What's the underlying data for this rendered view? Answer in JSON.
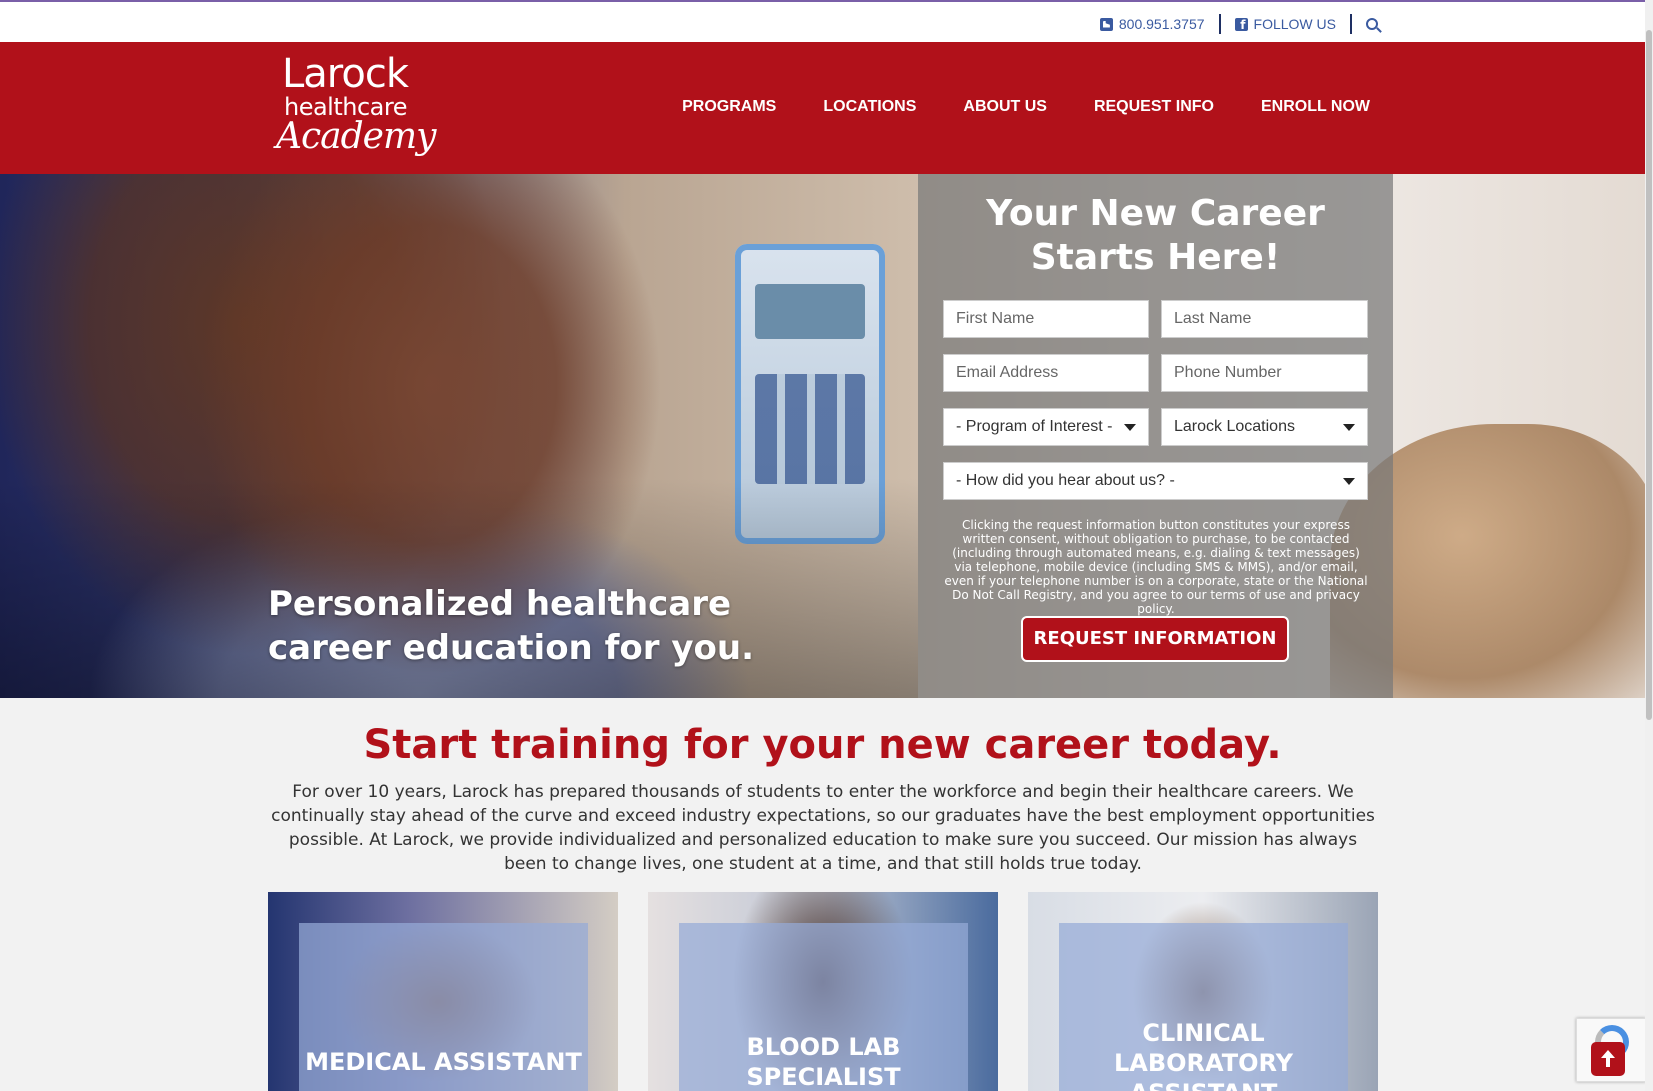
{
  "utility": {
    "phone": "800.951.3757",
    "follow": "FOLLOW US"
  },
  "logo": {
    "line1": "Larock",
    "line2": "healthcare",
    "line3": "Academy"
  },
  "nav": {
    "programs": "PROGRAMS",
    "locations": "LOCATIONS",
    "about": "ABOUT US",
    "request": "REQUEST INFO",
    "enroll": "ENROLL NOW"
  },
  "hero": {
    "tagline": "Personalized healthcare career education for you."
  },
  "form": {
    "title": "Your New Career Starts Here!",
    "first_name": "First Name",
    "last_name": "Last Name",
    "email": "Email Address",
    "phone": "Phone Number",
    "program": "- Program of Interest -",
    "location": "Larock Locations",
    "heard": "- How did you hear about us? -",
    "disclaimer": "Clicking the request information button constitutes your express written consent, without obligation to purchase, to be contacted (including through automated means, e.g. dialing & text messages) via telephone, mobile device (including SMS & MMS), and/or email, even if your telephone number is on a corporate, state or the National Do Not Call Registry, and you agree to our terms of use and privacy policy.",
    "submit": "REQUEST INFORMATION"
  },
  "intro": {
    "title": "Start training for your new career today.",
    "text": "For over 10 years, Larock has prepared thousands of students to enter the workforce and begin their healthcare careers. We continually stay ahead of the curve and exceed industry expectations, so our graduates have the best employment opportunities possible. At Larock, we provide individualized and personalized education to make sure you succeed. Our mission has always been to change lives, one student at a time, and that still holds true today."
  },
  "programs": [
    {
      "label": "MEDICAL ASSISTANT"
    },
    {
      "label": "BLOOD LAB SPECIALIST"
    },
    {
      "label": "CLINICAL LABORATORY ASSISTANT"
    }
  ],
  "colors": {
    "brand_red": "#b1111a",
    "link_blue": "#3a5aa0"
  }
}
